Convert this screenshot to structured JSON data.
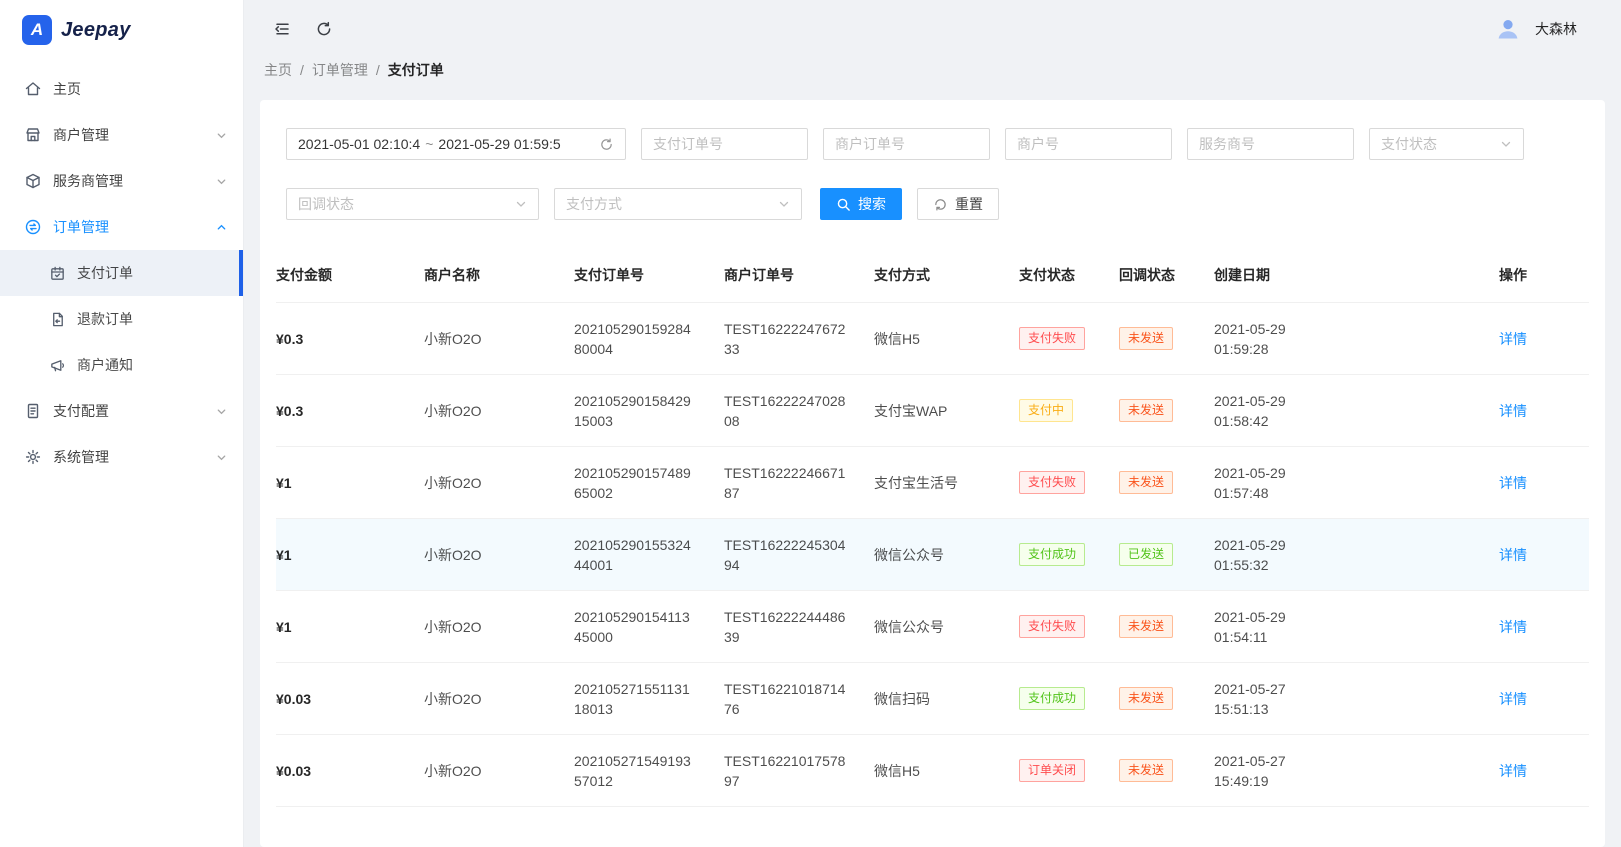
{
  "brand": {
    "name": "Jeepay",
    "mark": "A"
  },
  "topbar": {
    "username": "大森林"
  },
  "breadcrumb": {
    "items": [
      "主页",
      "订单管理",
      "支付订单"
    ]
  },
  "sidebar": {
    "items": [
      {
        "label": "主页"
      },
      {
        "label": "商户管理"
      },
      {
        "label": "服务商管理"
      },
      {
        "label": "订单管理",
        "children": [
          {
            "label": "支付订单"
          },
          {
            "label": "退款订单"
          },
          {
            "label": "商户通知"
          }
        ]
      },
      {
        "label": "支付配置"
      },
      {
        "label": "系统管理"
      }
    ]
  },
  "filters": {
    "date_start": "2021-05-01 02:10:4",
    "date_separator": "~",
    "date_end": "2021-05-29 01:59:5",
    "pay_order_no_placeholder": "支付订单号",
    "mch_order_no_placeholder": "商户订单号",
    "mch_no_placeholder": "商户号",
    "isv_no_placeholder": "服务商号",
    "pay_status_placeholder": "支付状态",
    "callback_status_placeholder": "回调状态",
    "pay_method_placeholder": "支付方式",
    "search_label": "搜索",
    "reset_label": "重置"
  },
  "table": {
    "columns": [
      "支付金额",
      "商户名称",
      "支付订单号",
      "商户订单号",
      "支付方式",
      "支付状态",
      "回调状态",
      "创建日期",
      "操作"
    ],
    "rows": [
      {
        "amount": "¥0.3",
        "merchant": "小新O2O",
        "pay_order_no": "20210529015928480004",
        "mch_order_no": "TEST1622224767233",
        "method": "微信H5",
        "pay_status": "支付失败",
        "pay_status_color": "red",
        "callback_status": "未发送",
        "callback_color": "orange",
        "created": "2021-05-29 01:59:28",
        "action": "详情"
      },
      {
        "amount": "¥0.3",
        "merchant": "小新O2O",
        "pay_order_no": "20210529015842915003",
        "mch_order_no": "TEST1622224702808",
        "method": "支付宝WAP",
        "pay_status": "支付中",
        "pay_status_color": "gold",
        "callback_status": "未发送",
        "callback_color": "orange",
        "created": "2021-05-29 01:58:42",
        "action": "详情"
      },
      {
        "amount": "¥1",
        "merchant": "小新O2O",
        "pay_order_no": "20210529015748965002",
        "mch_order_no": "TEST1622224667187",
        "method": "支付宝生活号",
        "pay_status": "支付失败",
        "pay_status_color": "red",
        "callback_status": "未发送",
        "callback_color": "orange",
        "created": "2021-05-29 01:57:48",
        "action": "详情"
      },
      {
        "amount": "¥1",
        "merchant": "小新O2O",
        "pay_order_no": "20210529015532444001",
        "mch_order_no": "TEST1622224530494",
        "method": "微信公众号",
        "pay_status": "支付成功",
        "pay_status_color": "green",
        "callback_status": "已发送",
        "callback_color": "green",
        "created": "2021-05-29 01:55:32",
        "action": "详情"
      },
      {
        "amount": "¥1",
        "merchant": "小新O2O",
        "pay_order_no": "20210529015411345000",
        "mch_order_no": "TEST1622224448639",
        "method": "微信公众号",
        "pay_status": "支付失败",
        "pay_status_color": "red",
        "callback_status": "未发送",
        "callback_color": "orange",
        "created": "2021-05-29 01:54:11",
        "action": "详情"
      },
      {
        "amount": "¥0.03",
        "merchant": "小新O2O",
        "pay_order_no": "20210527155113118013",
        "mch_order_no": "TEST1622101871476",
        "method": "微信扫码",
        "pay_status": "支付成功",
        "pay_status_color": "green",
        "callback_status": "未发送",
        "callback_color": "orange",
        "created": "2021-05-27 15:51:13",
        "action": "详情"
      },
      {
        "amount": "¥0.03",
        "merchant": "小新O2O",
        "pay_order_no": "20210527154919357012",
        "mch_order_no": "TEST1622101757897",
        "method": "微信H5",
        "pay_status": "订单关闭",
        "pay_status_color": "red",
        "callback_status": "未发送",
        "callback_color": "orange",
        "created": "2021-05-27 15:49:19",
        "action": "详情"
      }
    ]
  },
  "colors": {
    "primary": "#1890ff",
    "success": "#52c41a",
    "error": "#ff4d4f",
    "processing": "#faad14",
    "warning": "#fa541c",
    "sidebar_active_bar": "#1f61e8"
  },
  "icons": {
    "menu_fold": "☰",
    "refresh": "⟳",
    "calendar_sync": "⟳",
    "search": "⌕",
    "chevron_down": "∨",
    "chevron_up": "∧",
    "user_avatar": "👤"
  }
}
